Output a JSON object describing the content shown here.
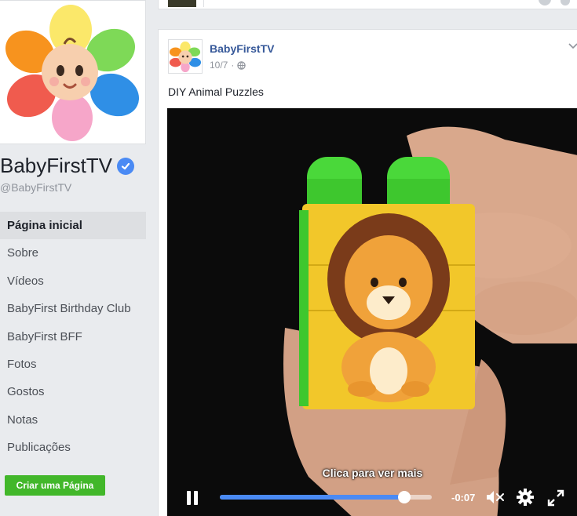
{
  "page": {
    "name": "BabyFirstTV",
    "handle": "@BabyFirstTV"
  },
  "sidebar": {
    "items": [
      {
        "label": "Página inicial",
        "active": true
      },
      {
        "label": "Sobre"
      },
      {
        "label": "Vídeos"
      },
      {
        "label": "BabyFirst Birthday Club"
      },
      {
        "label": "BabyFirst BFF"
      },
      {
        "label": "Fotos"
      },
      {
        "label": "Gostos"
      },
      {
        "label": "Notas"
      },
      {
        "label": "Publicações"
      }
    ],
    "create_page_label": "Criar uma Página"
  },
  "post": {
    "author": "BabyFirstTV",
    "date": "10/7",
    "separator": "·",
    "privacy_icon": "globe-icon",
    "text": "DIY Animal Puzzles",
    "video": {
      "caption": "Clica para ver mais",
      "time_remaining": "-0:07",
      "progress": 0.87,
      "state": "playing",
      "muted": true,
      "subject": "lion-puzzle-blocks"
    }
  },
  "colors": {
    "link_blue": "#365899",
    "verified_blue": "#4a8af4",
    "progress_blue": "#4a8af4",
    "create_button_green": "#42b72a",
    "active_nav_bg": "#dddfe2"
  }
}
